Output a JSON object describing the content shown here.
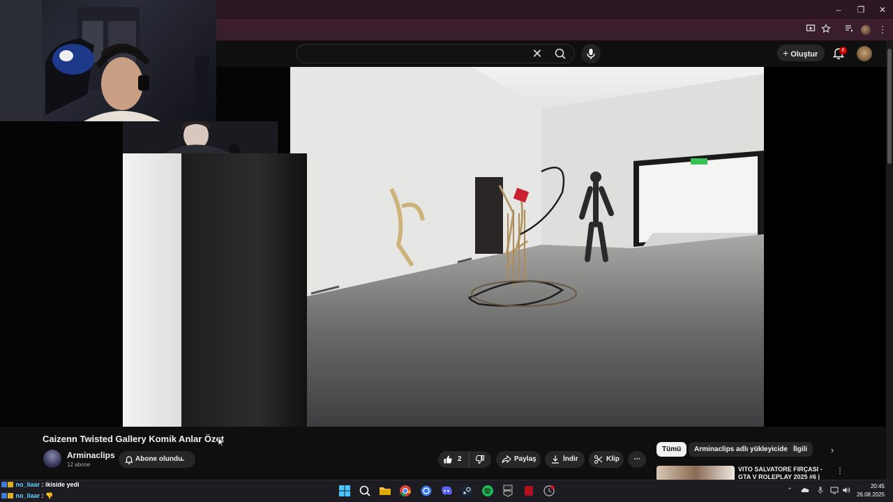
{
  "browser": {
    "window_controls": {
      "minimize": "–",
      "maximize": "❐",
      "close": "✕"
    }
  },
  "youtube": {
    "search": {
      "value": "",
      "placeholder": ""
    },
    "create_label": "Oluştur",
    "notifications_count": "6"
  },
  "video": {
    "title": "Caizenn Twisted Gallery Komik Anlar Özet",
    "channel": {
      "name": "Arminaclips",
      "subscribers": "12 abone"
    },
    "subscribe_label": "Abone olundu",
    "like_count": "2",
    "share_label": "Paylaş",
    "download_label": "İndir",
    "clip_label": "Klip",
    "more_label": "⋯"
  },
  "chips": {
    "items": [
      "Tümü",
      "Arminaclips adlı yükleyiciden",
      "İlgili"
    ],
    "next": "›"
  },
  "recommended": [
    {
      "title": "VITO SALVATORE FIRÇASI - GTA V ROLEPLAY 2025 #6 |",
      "menu": "⋮"
    }
  ],
  "chat": [
    {
      "user": "no_liaar",
      "message": "ikiside yedi"
    },
    {
      "user": "no_liaar",
      "message": "👎"
    }
  ],
  "taskbar": {
    "apps": [
      "windows-start",
      "search",
      "file-explorer",
      "chrome",
      "signal",
      "discord",
      "steam",
      "spotify",
      "epic-games",
      "app-red",
      "app-clock"
    ],
    "time": "20:45",
    "date": "26.08.2025"
  },
  "colors": {
    "browser_frame": "#3a1e2c",
    "yt_background": "#0f0f0f",
    "pill_background": "#272727",
    "notification_badge": "#cc0000",
    "chat_username": "#61d1ff"
  }
}
